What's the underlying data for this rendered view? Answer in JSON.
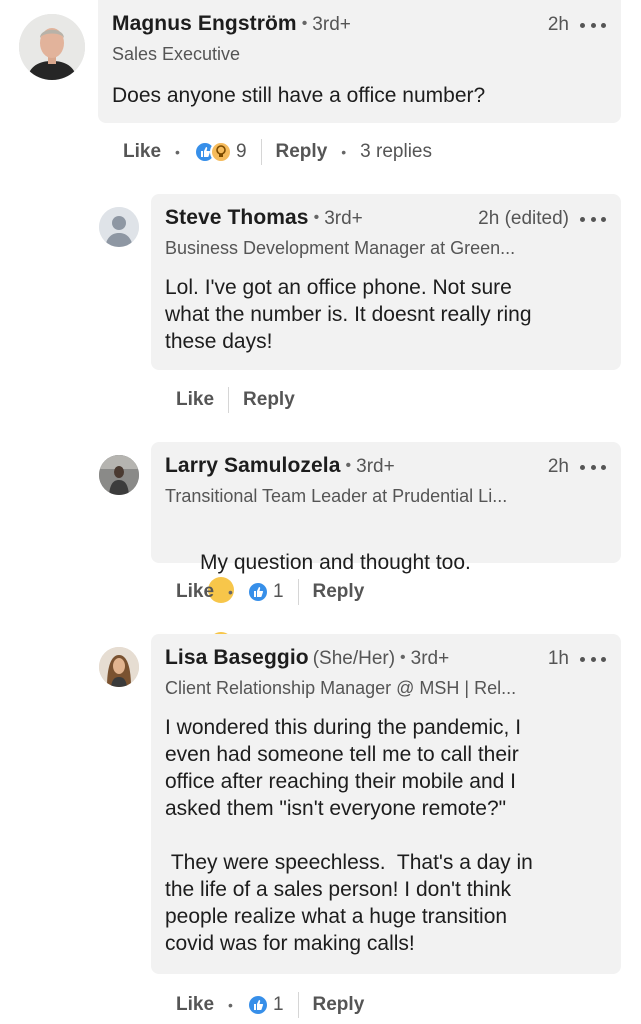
{
  "comments": [
    {
      "name": "Magnus Engström",
      "degree": "3rd+",
      "time": "2h",
      "headline": "Sales Executive",
      "text": "Does anyone still have a office number?",
      "actions": {
        "like": "Like",
        "reaction_count": "9",
        "reply": "Reply",
        "replies": "3 replies"
      }
    },
    {
      "name": "Steve Thomas",
      "degree": "3rd+",
      "time": "2h (edited)",
      "headline": "Business Development Manager at Green...",
      "text": "Lol. I've got an office phone. Not sure\nwhat the number is. It doesnt really ring\nthese days!",
      "actions": {
        "like": "Like",
        "reply": "Reply"
      }
    },
    {
      "name": "Larry Samulozela",
      "degree": "3rd+",
      "time": "2h",
      "headline": "Transitional Team Leader at Prudential Li...",
      "text": "My question and thought too.",
      "actions": {
        "like": "Like",
        "reaction_count": "1",
        "reply": "Reply"
      }
    },
    {
      "name": "Lisa Baseggio",
      "pronouns": "(She/Her)",
      "degree": "3rd+",
      "time": "1h",
      "headline": "Client Relationship Manager @ MSH | Rel...",
      "text": "I wondered this during the pandemic, I\neven had someone tell me to call their\noffice after reaching their mobile and I\nasked them \"isn't everyone remote?\"\n\n They were speechless.  That's a day in\nthe life of a sales person! I don't think\npeople realize what a huge transition\ncovid was for making calls!",
      "actions": {
        "like": "Like",
        "reaction_count": "1",
        "reply": "Reply"
      }
    }
  ],
  "colors": {
    "bubble": "#f2f2f2",
    "like_reaction": "#378fe9",
    "insightful_reaction": "#f5bb5c"
  },
  "icons": {
    "reaction_like": "thumbs-up-icon",
    "reaction_insightful": "lightbulb-icon",
    "emoji": "thinking-face-emoji",
    "more": "more-horizontal-icon"
  }
}
